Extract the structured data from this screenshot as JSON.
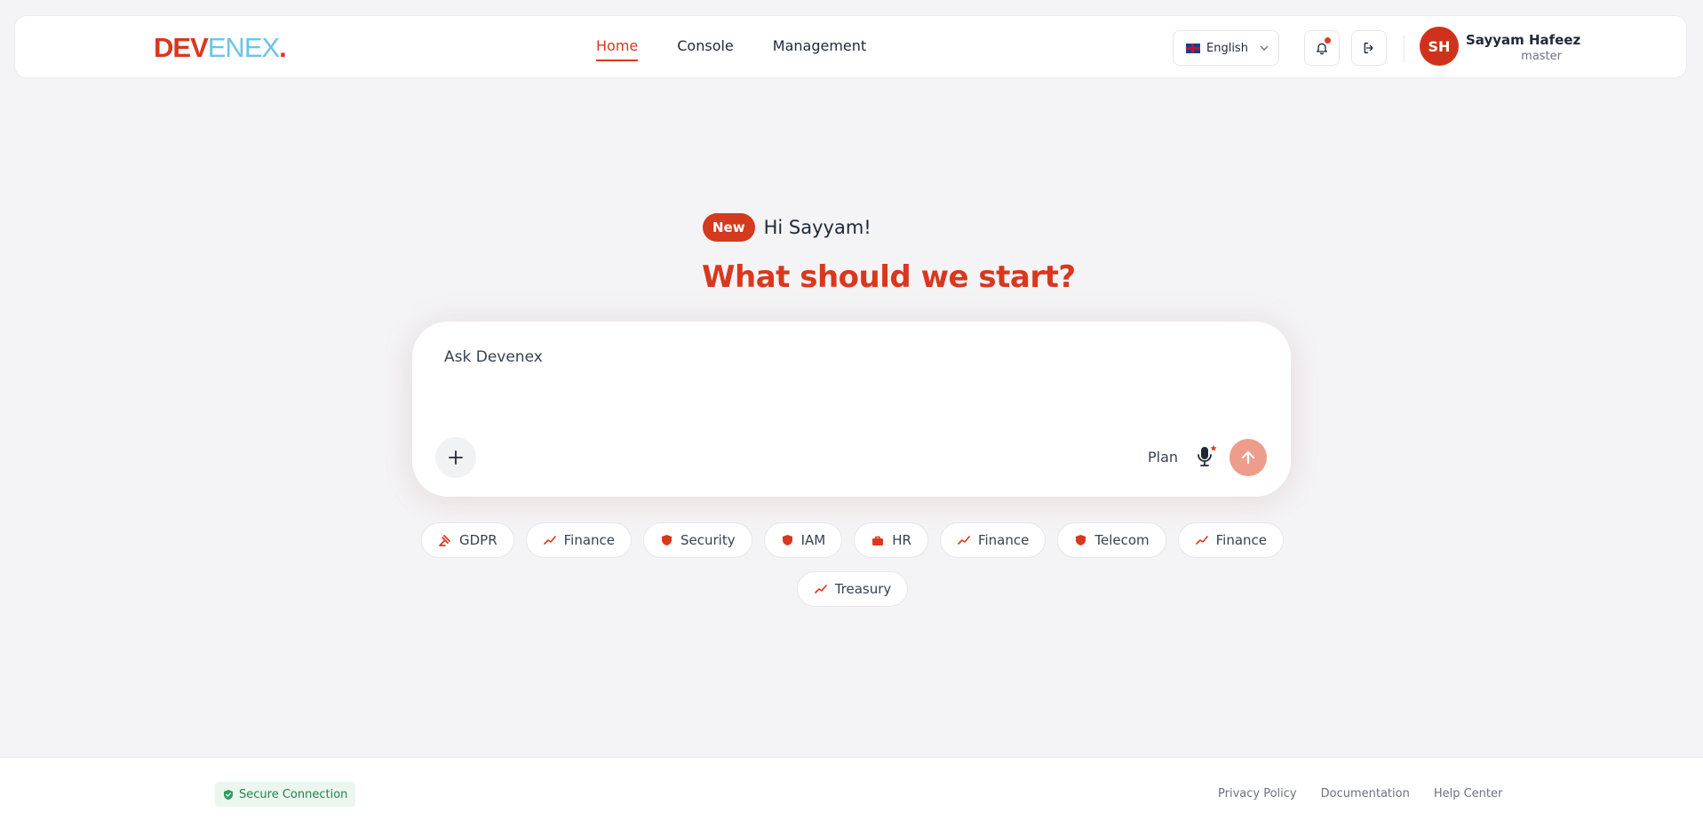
{
  "brand": {
    "part1": "DEV",
    "part2": "ENEX",
    "dot": "."
  },
  "nav": {
    "home": "Home",
    "console": "Console",
    "management": "Management"
  },
  "language": {
    "label": "English"
  },
  "user": {
    "initials": "SH",
    "name": "Sayyam Hafeez",
    "role": "master"
  },
  "hero": {
    "badge": "New",
    "greeting": "Hi Sayyam!",
    "headline": "What should we start?"
  },
  "chat": {
    "placeholder": "Ask Devenex",
    "plan_label": "Plan"
  },
  "chips": [
    {
      "label": "GDPR",
      "icon": "gavel-icon"
    },
    {
      "label": "Finance",
      "icon": "trend-icon"
    },
    {
      "label": "Security",
      "icon": "shield-icon"
    },
    {
      "label": "IAM",
      "icon": "shield-icon"
    },
    {
      "label": "HR",
      "icon": "briefcase-icon"
    },
    {
      "label": "Finance",
      "icon": "trend-icon"
    },
    {
      "label": "Telecom",
      "icon": "shield-icon"
    },
    {
      "label": "Finance",
      "icon": "trend-icon"
    },
    {
      "label": "Treasury",
      "icon": "trend-icon"
    }
  ],
  "footer": {
    "secure": "Secure Connection",
    "privacy": "Privacy Policy",
    "docs": "Documentation",
    "help": "Help Center"
  },
  "colors": {
    "accent": "#d9381e",
    "logo_light": "#6cc4e8",
    "send_disabled": "#ee9c8c",
    "secure_green": "#2e7d4f"
  }
}
